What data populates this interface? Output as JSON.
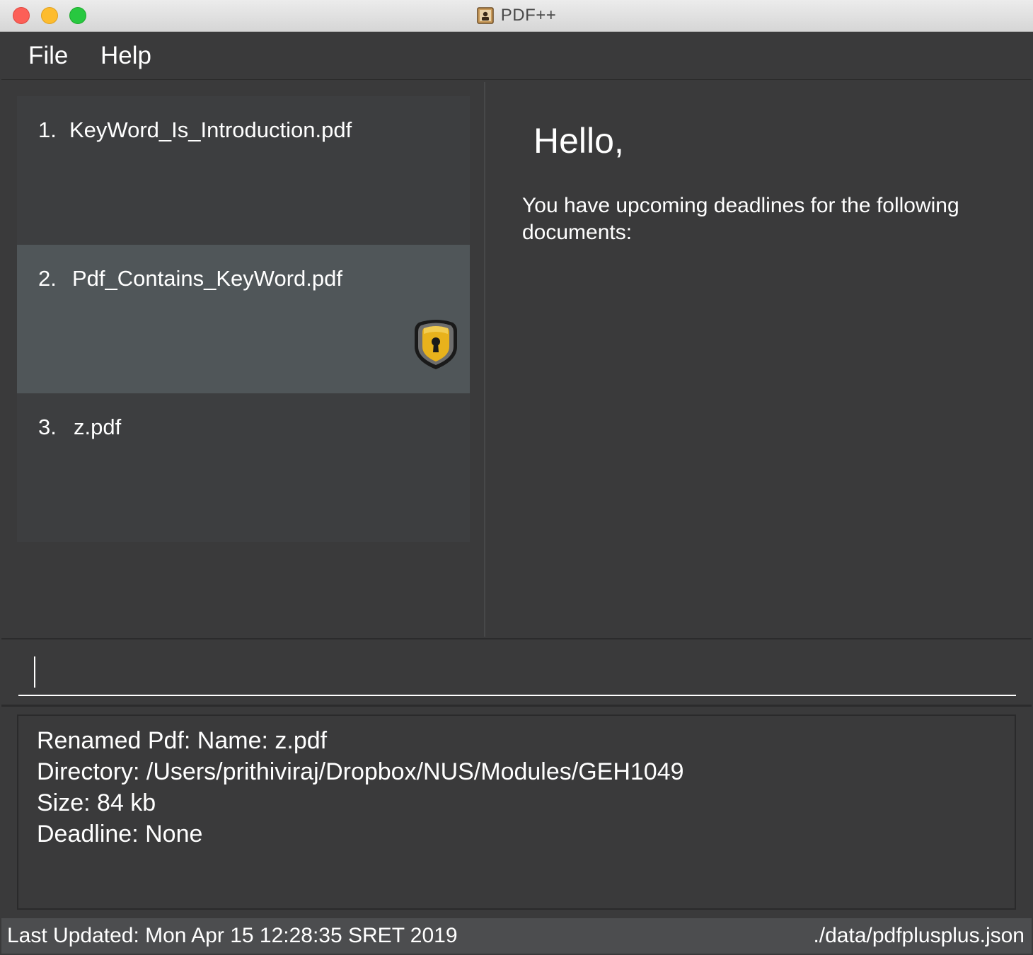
{
  "window": {
    "title": "PDF++"
  },
  "menu": {
    "items": [
      {
        "label": "File"
      },
      {
        "label": "Help"
      }
    ]
  },
  "pdf_list": {
    "items": [
      {
        "index": "1.",
        "name": "KeyWord_Is_Introduction.pdf",
        "locked": false,
        "selected": false
      },
      {
        "index": "2.",
        "name": "Pdf_Contains_KeyWord.pdf",
        "locked": true,
        "selected": true
      },
      {
        "index": "3.",
        "name": "z.pdf",
        "locked": false,
        "selected": false
      }
    ]
  },
  "deadline_panel": {
    "greeting": "Hello,",
    "message": "You have upcoming deadlines for the following documents:"
  },
  "command_box": {
    "value": ""
  },
  "result_display": {
    "lines": [
      "Renamed Pdf: Name: z.pdf",
      "Directory: /Users/prithiviraj/Dropbox/NUS/Modules/GEH1049",
      "Size: 84 kb",
      "Deadline: None"
    ]
  },
  "status_bar": {
    "last_updated": "Last Updated: Mon Apr 15 12:28:35 SRET 2019",
    "save_location": "./data/pdfplusplus.json"
  },
  "colors": {
    "background": "#3a3a3b",
    "selected_item": "#505659",
    "status_bar": "#4c4d4f",
    "lock_gold": "#e8b21c"
  },
  "icons": {
    "app": "app-icon",
    "lock": "lock-shield-icon"
  }
}
